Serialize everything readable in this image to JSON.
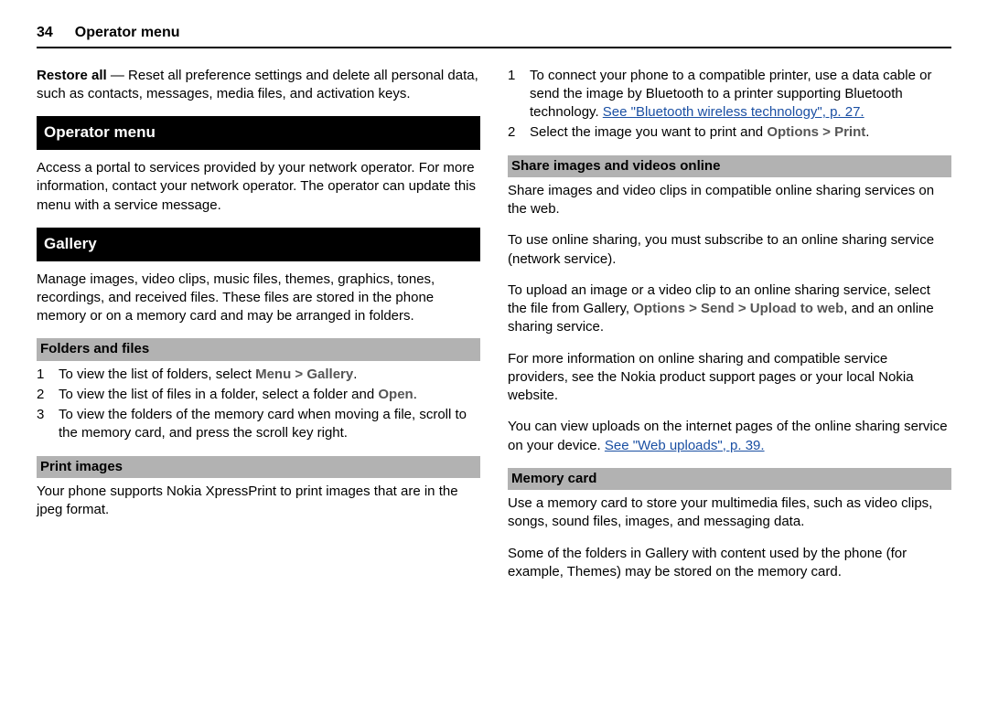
{
  "header": {
    "page_number": "34",
    "title": "Operator menu"
  },
  "left": {
    "restore_all_label": "Restore all",
    "restore_all_sep": "  —  ",
    "restore_all_text": "Reset all preference settings and delete all personal data, such as contacts, messages, media files, and activation keys.",
    "operator_menu_heading": "Operator menu",
    "operator_menu_text": "Access a portal to services provided by your network operator. For more information, contact your network operator. The operator can update this menu with a service message.",
    "gallery_heading": "Gallery",
    "gallery_text": "Manage images, video clips, music files, themes, graphics, tones, recordings, and received files. These files are stored in the phone memory or on a memory card and may be arranged in folders.",
    "folders_files_heading": "Folders and files",
    "folders_list": [
      {
        "num": "1",
        "pre": "To view the list of folders, select ",
        "path": "Menu > Gallery",
        "post": "."
      },
      {
        "num": "2",
        "pre": "To view the list of files in a folder, select a folder and ",
        "path": "Open",
        "post": "."
      },
      {
        "num": "3",
        "pre": "To view the folders of the memory card when moving a file, scroll to the memory card, and press the scroll key right.",
        "path": "",
        "post": ""
      }
    ],
    "print_images_heading": "Print images",
    "print_images_text": "Your phone supports Nokia XpressPrint to print images that are in the jpeg format."
  },
  "right": {
    "print_steps": [
      {
        "num": "1",
        "pre": "To connect your phone to a compatible printer, use a data cable or send the image by Bluetooth to a printer supporting Bluetooth technology. ",
        "link": "See \"Bluetooth wireless technology\", p. 27.",
        "path": "",
        "post": ""
      },
      {
        "num": "2",
        "pre": "Select the image you want to print and ",
        "link": "",
        "path": "Options > Print",
        "post": "."
      }
    ],
    "share_heading": "Share images and videos online",
    "share_p1": "Share images and video clips in compatible online sharing services on the web.",
    "share_p2": "To use online sharing, you must subscribe to an online sharing service (network service).",
    "share_p3_pre": "To upload an image or a video clip to an online sharing service, select the file from Gallery, ",
    "share_p3_path": "Options > Send > Upload to web",
    "share_p3_post": ", and an online sharing service.",
    "share_p4": "For more information on online sharing and compatible service providers, see the Nokia product support pages or your local Nokia website.",
    "share_p5_pre": "You can view uploads on the internet pages of the online sharing service on your device. ",
    "share_p5_link": "See \"Web uploads\", p. 39.",
    "memory_heading": "Memory card",
    "memory_p1": "Use a memory card to store your multimedia files, such as video clips, songs, sound files, images, and messaging data.",
    "memory_p2": "Some of the folders in Gallery with content used by the phone (for example, Themes) may be stored on the memory card."
  }
}
